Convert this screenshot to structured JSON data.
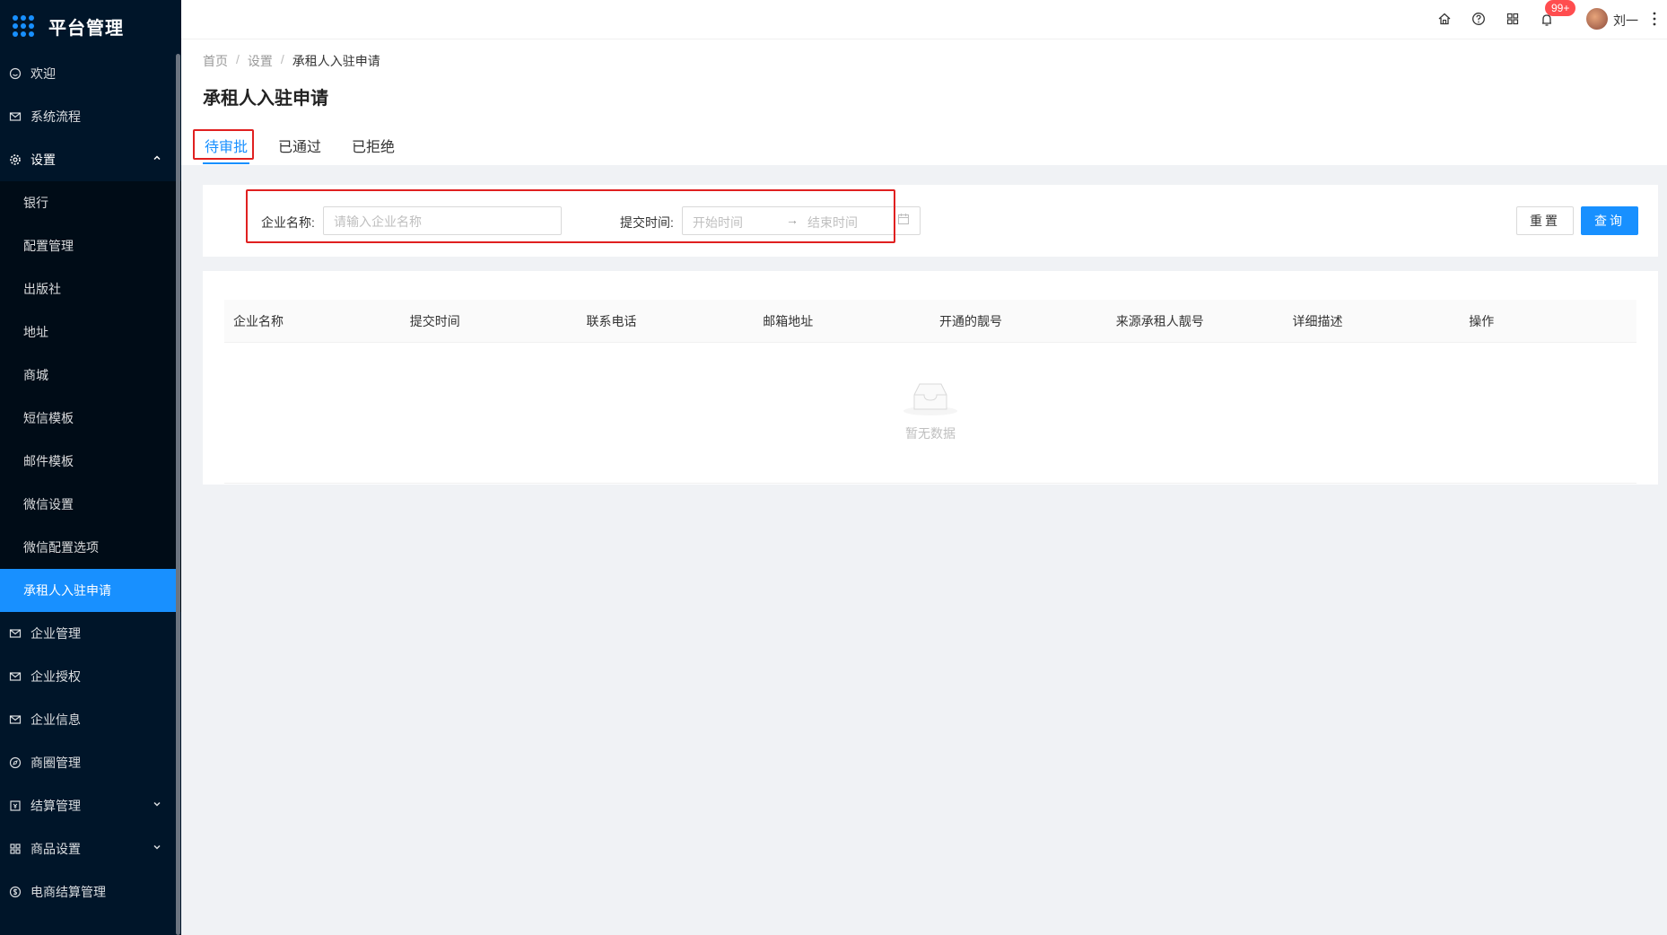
{
  "app": {
    "title": "平台管理"
  },
  "sidebar": {
    "items": [
      {
        "label": "欢迎",
        "icon": "smile-icon"
      },
      {
        "label": "系统流程",
        "icon": "mail-icon"
      },
      {
        "label": "设置",
        "icon": "gear-icon",
        "expanded": true
      },
      {
        "label": "企业管理",
        "icon": "mail-icon"
      },
      {
        "label": "企业授权",
        "icon": "mail-icon"
      },
      {
        "label": "企业信息",
        "icon": "mail-icon"
      },
      {
        "label": "商圈管理",
        "icon": "compass-icon"
      },
      {
        "label": "结算管理",
        "icon": "account-book-icon"
      },
      {
        "label": "商品设置",
        "icon": "appstore-icon"
      },
      {
        "label": "电商结算管理",
        "icon": "dollar-icon"
      }
    ],
    "settings_children": [
      "银行",
      "配置管理",
      "出版社",
      "地址",
      "商城",
      "短信模板",
      "邮件模板",
      "微信设置",
      "微信配置选项",
      "承租人入驻申请"
    ],
    "active_child": "承租人入驻申请"
  },
  "header": {
    "notification_count": "99+",
    "username": "刘一"
  },
  "breadcrumb": [
    "首页",
    "设置",
    "承租人入驻申请"
  ],
  "page": {
    "title": "承租人入驻申请",
    "tabs": [
      "待审批",
      "已通过",
      "已拒绝"
    ],
    "active_tab": "待审批"
  },
  "filter": {
    "company_label": "企业名称:",
    "company_placeholder": "请输入企业名称",
    "time_label": "提交时间:",
    "start_placeholder": "开始时间",
    "end_placeholder": "结束时间",
    "range_separator": "→",
    "reset_label": "重置",
    "query_label": "查询"
  },
  "table": {
    "columns": [
      "企业名称",
      "提交时间",
      "联系电话",
      "邮箱地址",
      "开通的靓号",
      "来源承租人靓号",
      "详细描述",
      "操作"
    ],
    "rows": [],
    "empty_text": "暂无数据"
  },
  "colors": {
    "primary": "#1890ff",
    "sidebar_bg": "#001529",
    "highlight": "#e02020",
    "badge": "#ff4d4f"
  }
}
